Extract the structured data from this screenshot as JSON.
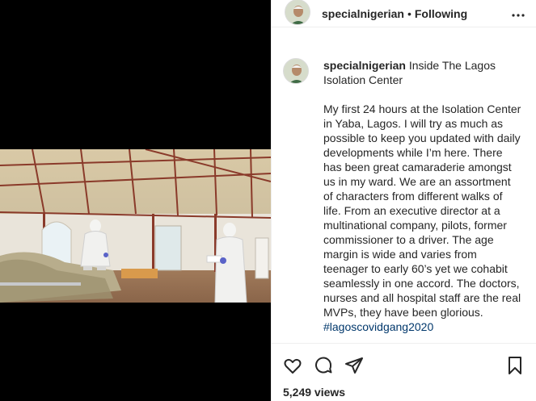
{
  "header": {
    "username": "specialnigerian",
    "separator": "•",
    "follow_status": "Following",
    "more_icon": "more-options-icon"
  },
  "caption": {
    "username": "specialnigerian",
    "title": "Inside The Lagos Isolation Center",
    "text": "My first 24 hours at the Isolation Center in Yaba, Lagos. I will try as much as possible to keep you updated with daily developments while I’m here. There has been great camaraderie amongst us in my ward. We are an assortment of characters from different walks of life. From an executive director at a multinational company, pilots, former commissioner to a driver. The age margin is wide and varies from teenager to early 60’s yet we cohabit seamlessly in one accord. The doctors, nurses and all hospital staff are the real MVPs, they have been glorious.",
    "hashtag": "#lagoscovidgang2020"
  },
  "actions": {
    "like_icon": "heart-icon",
    "comment_icon": "comment-icon",
    "share_icon": "share-icon",
    "save_icon": "bookmark-icon"
  },
  "views": "5,249 views",
  "colors": {
    "text": "#262626",
    "link": "#00376b",
    "divider": "#efefef",
    "media_bg": "#000000"
  }
}
